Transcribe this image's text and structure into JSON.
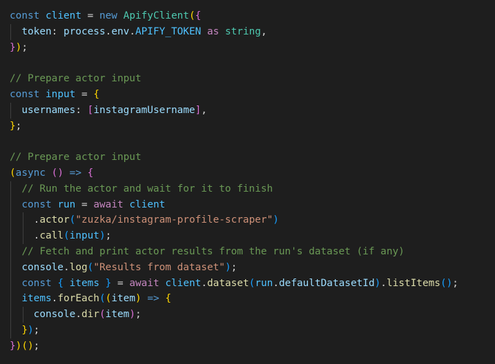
{
  "editor": {
    "theme": {
      "background": "#1e1e1e",
      "keyword": "#569cd6",
      "control": "#c586c0",
      "function": "#dcdcaa",
      "variable": "#9cdcfe",
      "constant": "#4fc1ff",
      "class": "#4ec9b0",
      "string": "#ce9178",
      "comment": "#6a9955",
      "bracket_level_1": "#ffd700",
      "bracket_level_2": "#da70d6",
      "bracket_level_3": "#179fff"
    },
    "lines": [
      {
        "indent": 0,
        "guides": [],
        "tokens": [
          {
            "t": "const",
            "c": "kw"
          },
          {
            "t": " ",
            "c": "op"
          },
          {
            "t": "client",
            "c": "cst"
          },
          {
            "t": " = ",
            "c": "op"
          },
          {
            "t": "new",
            "c": "kw"
          },
          {
            "t": " ",
            "c": "op"
          },
          {
            "t": "ApifyClient",
            "c": "cls"
          },
          {
            "t": "(",
            "c": "b1"
          },
          {
            "t": "{",
            "c": "b2"
          }
        ]
      },
      {
        "indent": 0,
        "guides": [
          1
        ],
        "tokens": [
          {
            "t": "  ",
            "c": "op"
          },
          {
            "t": "token",
            "c": "var"
          },
          {
            "t": ": ",
            "c": "op"
          },
          {
            "t": "process",
            "c": "var"
          },
          {
            "t": ".",
            "c": "op"
          },
          {
            "t": "env",
            "c": "var"
          },
          {
            "t": ".",
            "c": "op"
          },
          {
            "t": "APIFY_TOKEN",
            "c": "cst"
          },
          {
            "t": " ",
            "c": "op"
          },
          {
            "t": "as",
            "c": "ctl"
          },
          {
            "t": " ",
            "c": "op"
          },
          {
            "t": "string",
            "c": "cls"
          },
          {
            "t": ",",
            "c": "op"
          }
        ]
      },
      {
        "indent": 0,
        "guides": [],
        "tokens": [
          {
            "t": "}",
            "c": "b2"
          },
          {
            "t": ")",
            "c": "b1"
          },
          {
            "t": ";",
            "c": "op"
          }
        ]
      },
      {
        "indent": 0,
        "guides": [],
        "tokens": []
      },
      {
        "indent": 0,
        "guides": [],
        "tokens": [
          {
            "t": "// Prepare actor input",
            "c": "cmt"
          }
        ]
      },
      {
        "indent": 0,
        "guides": [],
        "tokens": [
          {
            "t": "const",
            "c": "kw"
          },
          {
            "t": " ",
            "c": "op"
          },
          {
            "t": "input",
            "c": "cst"
          },
          {
            "t": " = ",
            "c": "op"
          },
          {
            "t": "{",
            "c": "b1"
          }
        ]
      },
      {
        "indent": 0,
        "guides": [
          1
        ],
        "tokens": [
          {
            "t": "  ",
            "c": "op"
          },
          {
            "t": "usernames",
            "c": "var"
          },
          {
            "t": ": ",
            "c": "op"
          },
          {
            "t": "[",
            "c": "b2"
          },
          {
            "t": "instagramUsername",
            "c": "var"
          },
          {
            "t": "]",
            "c": "b2"
          },
          {
            "t": ",",
            "c": "op"
          }
        ]
      },
      {
        "indent": 0,
        "guides": [],
        "tokens": [
          {
            "t": "}",
            "c": "b1"
          },
          {
            "t": ";",
            "c": "op"
          }
        ]
      },
      {
        "indent": 0,
        "guides": [],
        "tokens": []
      },
      {
        "indent": 0,
        "guides": [],
        "tokens": [
          {
            "t": "// Prepare actor input",
            "c": "cmt"
          }
        ]
      },
      {
        "indent": 0,
        "guides": [],
        "tokens": [
          {
            "t": "(",
            "c": "b1"
          },
          {
            "t": "async",
            "c": "kw"
          },
          {
            "t": " ",
            "c": "op"
          },
          {
            "t": "()",
            "c": "b2"
          },
          {
            "t": " ",
            "c": "op"
          },
          {
            "t": "=>",
            "c": "kw"
          },
          {
            "t": " ",
            "c": "op"
          },
          {
            "t": "{",
            "c": "b2"
          }
        ]
      },
      {
        "indent": 0,
        "guides": [
          1
        ],
        "tokens": [
          {
            "t": "  ",
            "c": "op"
          },
          {
            "t": "// Run the actor and wait for it to finish",
            "c": "cmt"
          }
        ]
      },
      {
        "indent": 0,
        "guides": [
          1
        ],
        "tokens": [
          {
            "t": "  ",
            "c": "op"
          },
          {
            "t": "const",
            "c": "kw"
          },
          {
            "t": " ",
            "c": "op"
          },
          {
            "t": "run",
            "c": "cst"
          },
          {
            "t": " = ",
            "c": "op"
          },
          {
            "t": "await",
            "c": "ctl"
          },
          {
            "t": " ",
            "c": "op"
          },
          {
            "t": "client",
            "c": "cst"
          }
        ]
      },
      {
        "indent": 0,
        "guides": [
          1,
          2
        ],
        "tokens": [
          {
            "t": "    ",
            "c": "op"
          },
          {
            "t": ".",
            "c": "op"
          },
          {
            "t": "actor",
            "c": "fn"
          },
          {
            "t": "(",
            "c": "b3"
          },
          {
            "t": "\"zuzka/instagram-profile-scraper\"",
            "c": "str"
          },
          {
            "t": ")",
            "c": "b3"
          }
        ]
      },
      {
        "indent": 0,
        "guides": [
          1,
          2
        ],
        "tokens": [
          {
            "t": "    ",
            "c": "op"
          },
          {
            "t": ".",
            "c": "op"
          },
          {
            "t": "call",
            "c": "fn"
          },
          {
            "t": "(",
            "c": "b3"
          },
          {
            "t": "input",
            "c": "cst"
          },
          {
            "t": ")",
            "c": "b3"
          },
          {
            "t": ";",
            "c": "op"
          }
        ]
      },
      {
        "indent": 0,
        "guides": [
          1
        ],
        "tokens": [
          {
            "t": "  ",
            "c": "op"
          },
          {
            "t": "// Fetch and print actor results from the run's dataset (if any)",
            "c": "cmt"
          }
        ]
      },
      {
        "indent": 0,
        "guides": [
          1
        ],
        "tokens": [
          {
            "t": "  ",
            "c": "op"
          },
          {
            "t": "console",
            "c": "var"
          },
          {
            "t": ".",
            "c": "op"
          },
          {
            "t": "log",
            "c": "fn"
          },
          {
            "t": "(",
            "c": "b3"
          },
          {
            "t": "\"Results from dataset\"",
            "c": "str"
          },
          {
            "t": ")",
            "c": "b3"
          },
          {
            "t": ";",
            "c": "op"
          }
        ]
      },
      {
        "indent": 0,
        "guides": [
          1
        ],
        "tokens": [
          {
            "t": "  ",
            "c": "op"
          },
          {
            "t": "const",
            "c": "kw"
          },
          {
            "t": " ",
            "c": "op"
          },
          {
            "t": "{",
            "c": "b3"
          },
          {
            "t": " ",
            "c": "op"
          },
          {
            "t": "items",
            "c": "cst"
          },
          {
            "t": " ",
            "c": "op"
          },
          {
            "t": "}",
            "c": "b3"
          },
          {
            "t": " = ",
            "c": "op"
          },
          {
            "t": "await",
            "c": "ctl"
          },
          {
            "t": " ",
            "c": "op"
          },
          {
            "t": "client",
            "c": "cst"
          },
          {
            "t": ".",
            "c": "op"
          },
          {
            "t": "dataset",
            "c": "fn"
          },
          {
            "t": "(",
            "c": "b3"
          },
          {
            "t": "run",
            "c": "cst"
          },
          {
            "t": ".",
            "c": "op"
          },
          {
            "t": "defaultDatasetId",
            "c": "var"
          },
          {
            "t": ")",
            "c": "b3"
          },
          {
            "t": ".",
            "c": "op"
          },
          {
            "t": "listItems",
            "c": "fn"
          },
          {
            "t": "(",
            "c": "b3"
          },
          {
            "t": ")",
            "c": "b3"
          },
          {
            "t": ";",
            "c": "op"
          }
        ]
      },
      {
        "indent": 0,
        "guides": [
          1
        ],
        "tokens": [
          {
            "t": "  ",
            "c": "op"
          },
          {
            "t": "items",
            "c": "cst"
          },
          {
            "t": ".",
            "c": "op"
          },
          {
            "t": "forEach",
            "c": "fn"
          },
          {
            "t": "(",
            "c": "b3"
          },
          {
            "t": "(",
            "c": "b1"
          },
          {
            "t": "item",
            "c": "var"
          },
          {
            "t": ")",
            "c": "b1"
          },
          {
            "t": " ",
            "c": "op"
          },
          {
            "t": "=>",
            "c": "kw"
          },
          {
            "t": " ",
            "c": "op"
          },
          {
            "t": "{",
            "c": "b1"
          }
        ]
      },
      {
        "indent": 0,
        "guides": [
          1,
          2
        ],
        "tokens": [
          {
            "t": "    ",
            "c": "op"
          },
          {
            "t": "console",
            "c": "var"
          },
          {
            "t": ".",
            "c": "op"
          },
          {
            "t": "dir",
            "c": "fn"
          },
          {
            "t": "(",
            "c": "b2"
          },
          {
            "t": "item",
            "c": "var"
          },
          {
            "t": ")",
            "c": "b2"
          },
          {
            "t": ";",
            "c": "op"
          }
        ]
      },
      {
        "indent": 0,
        "guides": [
          1
        ],
        "tokens": [
          {
            "t": "  ",
            "c": "op"
          },
          {
            "t": "}",
            "c": "b1"
          },
          {
            "t": ")",
            "c": "b3"
          },
          {
            "t": ";",
            "c": "op"
          }
        ]
      },
      {
        "indent": 0,
        "guides": [],
        "tokens": [
          {
            "t": "}",
            "c": "b2"
          },
          {
            "t": ")",
            "c": "b1"
          },
          {
            "t": "()",
            "c": "b1"
          },
          {
            "t": ";",
            "c": "op"
          }
        ]
      }
    ]
  }
}
